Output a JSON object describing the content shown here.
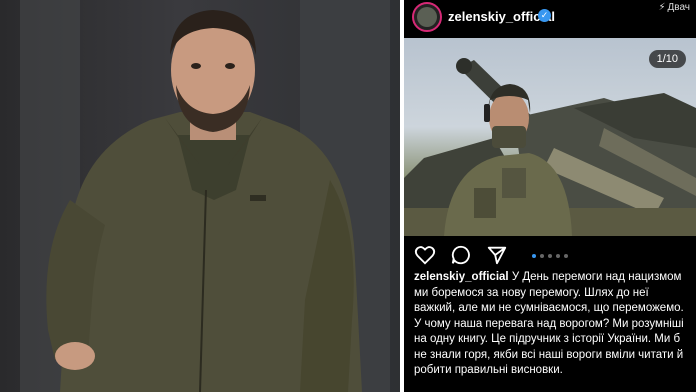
{
  "post": {
    "username": "zelenskiy_official",
    "verified_mark": "✓",
    "watermark": "Двач",
    "image_counter": "1/10",
    "carousel": {
      "total_dots": 5,
      "active_index": 0
    },
    "caption_text": "У День перемоги над нацизмом ми боремося за нову перемогу. Шлях до неї важкий, але ми не сумніваємося, що переможемо. У чому наша перевага над ворогом? Ми розумніші на одну книгу. Це підручник з історії України. Ми б не знали горя, якби всі наші вороги вміли читати й робити правильні висновки."
  },
  "icons": {
    "like": "heart-icon",
    "comment": "comment-icon",
    "share": "share-icon",
    "watermark": "bolt-icon"
  },
  "colors": {
    "background": "#000000",
    "verified": "#3897f0",
    "avatar_ring": "#d62976",
    "jacket": "#4f4e3a"
  }
}
